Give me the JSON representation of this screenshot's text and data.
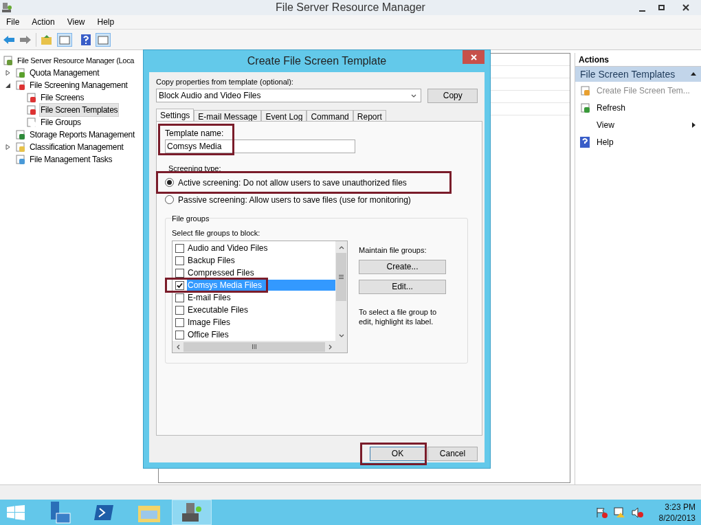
{
  "window": {
    "title": "File Server Resource Manager"
  },
  "menu": [
    "File",
    "Action",
    "View",
    "Help"
  ],
  "tree": [
    {
      "label": "File Server Resource Manager (Loca",
      "children": [
        {
          "label": "Quota Management",
          "expanded": false
        },
        {
          "label": "File Screening Management",
          "expanded": true,
          "children": [
            {
              "label": "File Screens",
              "selected": false
            },
            {
              "label": "File Screen Templates",
              "selected": true
            },
            {
              "label": "File Groups",
              "selected": false
            }
          ]
        },
        {
          "label": "Storage Reports Management"
        },
        {
          "label": "Classification Management",
          "expanded": false
        },
        {
          "label": "File Management Tasks"
        }
      ]
    }
  ],
  "actions": {
    "header": "Actions",
    "section": "File Screen Templates",
    "items": [
      {
        "label": "Create File Screen Tem...",
        "kind": "item",
        "disabled": true
      },
      {
        "label": "Refresh",
        "kind": "item",
        "disabled": false
      },
      {
        "label": "View",
        "kind": "submenu",
        "disabled": false
      },
      {
        "label": "Help",
        "kind": "item",
        "disabled": false
      }
    ]
  },
  "dialog": {
    "title": "Create File Screen Template",
    "copy_label": "Copy properties from template (optional):",
    "template_select": "Block Audio and Video Files",
    "copy_button": "Copy",
    "tabs": [
      {
        "label": "Settings",
        "selected": true
      },
      {
        "label": "E-mail Message",
        "selected": false
      },
      {
        "label": "Event Log",
        "selected": false
      },
      {
        "label": "Command",
        "selected": false
      },
      {
        "label": "Report",
        "selected": false
      }
    ],
    "template_name_label": "Template name:",
    "template_name": "Comsys Media",
    "screening_type_label": "Screening type:",
    "screening": [
      {
        "label": "Active screening: Do not allow users to save unauthorized files",
        "selected": true
      },
      {
        "label": "Passive screening: Allow users to save files (use for monitoring)",
        "selected": false
      }
    ],
    "file_groups_legend": "File groups",
    "select_label": "Select file groups to block:",
    "file_groups": [
      {
        "label": "Audio and Video Files",
        "checked": false,
        "selected": false
      },
      {
        "label": "Backup Files",
        "checked": false,
        "selected": false
      },
      {
        "label": "Compressed Files",
        "checked": false,
        "selected": false
      },
      {
        "label": "Comsys Media Files",
        "checked": true,
        "selected": true
      },
      {
        "label": "E-mail Files",
        "checked": false,
        "selected": false
      },
      {
        "label": "Executable Files",
        "checked": false,
        "selected": false
      },
      {
        "label": "Image Files",
        "checked": false,
        "selected": false
      },
      {
        "label": "Office Files",
        "checked": false,
        "selected": false
      }
    ],
    "maintain_label": "Maintain file groups:",
    "create_button": "Create...",
    "edit_button": "Edit...",
    "hint": "To select a file group to edit, highlight its label.",
    "ok_button": "OK",
    "cancel_button": "Cancel"
  },
  "taskbar": {
    "time": "3:23 PM",
    "date": "8/20/2013"
  }
}
